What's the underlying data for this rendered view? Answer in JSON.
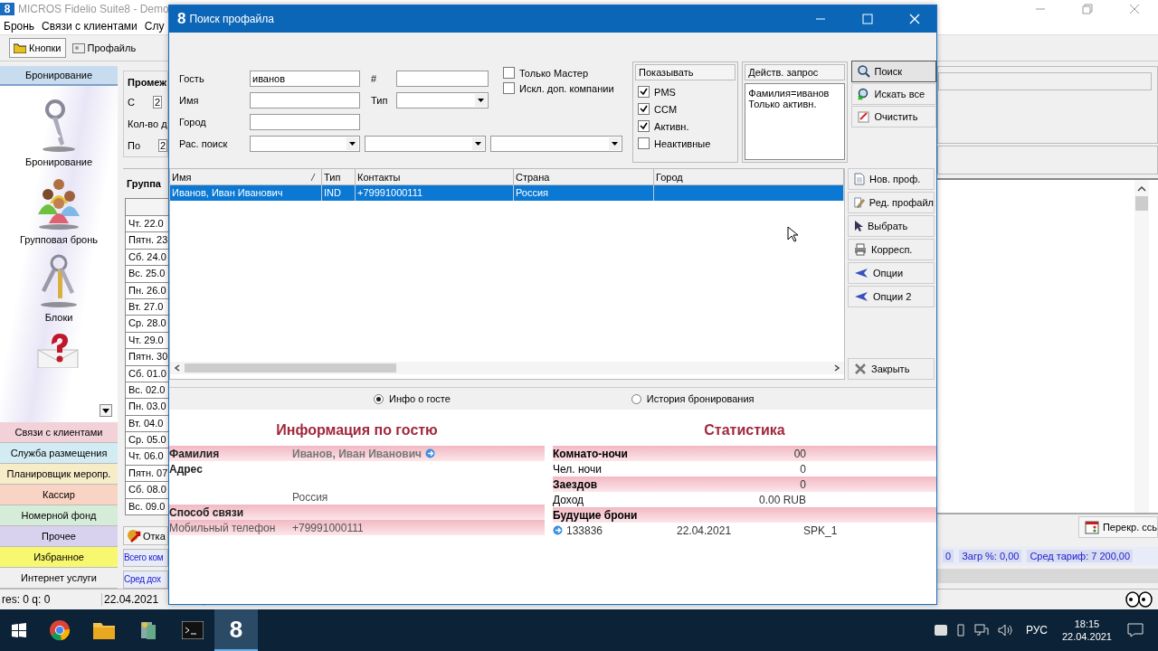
{
  "app": {
    "logo": "8",
    "title": "MICROS Fidelio Suite8 - Demo",
    "menu": [
      "Бронь",
      "Связи с клиентами",
      "Слу"
    ],
    "toolbar": [
      {
        "label": "Кнопки",
        "kind": "buttons",
        "selected": true
      },
      {
        "label": "Профайль",
        "kind": "profile",
        "selected": false
      }
    ]
  },
  "sidebar": {
    "header": "Бронирование",
    "shortcuts": [
      {
        "label": "Бронирование",
        "kind": "key"
      },
      {
        "label": "Групповая бронь",
        "kind": "people"
      },
      {
        "label": "Блоки",
        "kind": "keys"
      },
      {
        "kind": "help"
      }
    ],
    "sections": [
      {
        "label": "Связи с клиентами",
        "color": "#f2d2d8"
      },
      {
        "label": "Служба размещения",
        "color": "#d3ecf4"
      },
      {
        "label": "Планировщик меропр.",
        "color": "#f7ecc8"
      },
      {
        "label": "Кассир",
        "color": "#f9d3c3"
      },
      {
        "label": "Номерной фонд",
        "color": "#d5ecd8"
      },
      {
        "label": "Прочее",
        "color": "#d8d2ee"
      },
      {
        "label": "Избранное",
        "color": "#f8f870"
      },
      {
        "label": "Интернет услуги",
        "color": "#f0f0f0"
      }
    ]
  },
  "middle": {
    "period_title": "Промеж",
    "fields": [
      {
        "label": "С",
        "value": "2"
      },
      {
        "label": "Кол-во д"
      },
      {
        "label": "По",
        "value": "2"
      }
    ],
    "group_title": "Группа",
    "dates": [
      "Чт. 22.0",
      "Пятн. 23",
      "Сб. 24.0",
      "Вс. 25.0",
      "Пн. 26.0",
      "Вт. 27.0",
      "Ср. 28.0",
      "Чт. 29.0",
      "Пятн. 30",
      "Сб. 01.0",
      "Вс. 02.0",
      "Пн. 03.0",
      "Вт. 04.0",
      "Ср. 05.0",
      "Чт. 06.0",
      "Пятн. 07",
      "Сб. 08.0",
      "Вс. 09.0"
    ],
    "cancel_button": "Отка",
    "totals": [
      "Всего ком",
      "Сред дох"
    ]
  },
  "right_panel": {
    "overbook_button": "Перекр. ссь",
    "stats": [
      "0",
      "Загр %: 0,00",
      "Сред тариф: 7 200,00"
    ]
  },
  "status_bar": [
    "res: 0 q: 0",
    "22.04.2021"
  ],
  "dialog": {
    "logo": "8",
    "title": "Поиск профайла",
    "search": {
      "fields": [
        {
          "label": "Гость",
          "value": "иванов"
        },
        {
          "label": "Имя"
        },
        {
          "label": "Город"
        }
      ],
      "number_label": "#",
      "type_label": "Тип",
      "wide_search_label": "Рас. поиск",
      "checks": [
        {
          "label": "Только Мастер",
          "checked": false
        },
        {
          "label": "Искл. доп. компании",
          "checked": false
        }
      ]
    },
    "show": {
      "title": "Показывать",
      "options": [
        {
          "label": "PMS",
          "checked": true
        },
        {
          "label": "CCM",
          "checked": true
        },
        {
          "label": "Активн.",
          "checked": true
        },
        {
          "label": "Неактивные",
          "checked": false
        }
      ]
    },
    "query": {
      "title": "Действ. запрос",
      "lines": [
        "Фамилия=иванов",
        "Только активн."
      ]
    },
    "top_buttons": [
      {
        "label": "Поиск",
        "kind": "search"
      },
      {
        "label": "Искать все",
        "kind": "search-all"
      },
      {
        "label": "Очистить",
        "kind": "clear"
      }
    ],
    "table": {
      "columns": [
        "Имя",
        "Тип",
        "Контакты",
        "Страна",
        "Город"
      ],
      "rows": [
        {
          "name": "Иванов, Иван Иванович",
          "type": "IND",
          "contacts": "+79991000111",
          "country": "Россия",
          "selected": true
        }
      ]
    },
    "side_buttons": [
      {
        "label": "Нов. проф.",
        "kind": "new"
      },
      {
        "label": "Ред. профайл",
        "kind": "edit"
      },
      {
        "label": "Выбрать",
        "kind": "select"
      },
      {
        "label": "Корресп.",
        "kind": "print"
      },
      {
        "label": "Опции",
        "kind": "options"
      },
      {
        "label": "Опции 2",
        "kind": "options"
      }
    ],
    "close_button": "Закрыть",
    "views": [
      {
        "label": "Инфо о госте",
        "selected": true
      },
      {
        "label": "История бронирования",
        "selected": false
      }
    ],
    "guest_info": {
      "title": "Информация по гостю",
      "rows": [
        {
          "label": "Фамилия",
          "value": "Иванов, Иван Иванович",
          "kind": "name",
          "shaded": true
        },
        {
          "label": "Адрес",
          "kind": "heading",
          "shaded": false
        },
        {
          "value": "Россия",
          "kind": "detail",
          "shaded": false
        },
        {
          "label": "Способ связи",
          "kind": "heading",
          "shaded": true
        },
        {
          "label": "Мобильный телефон",
          "value": "+79991000111",
          "kind": "detail",
          "shaded": true
        }
      ]
    },
    "stats": {
      "title": "Статистика",
      "rows": [
        {
          "label": "Комнато-ночи",
          "value": "00",
          "shaded": true
        },
        {
          "label": "Чел. ночи",
          "value": "0",
          "shaded": false
        },
        {
          "label": "Заездов",
          "value": "0",
          "shaded": true
        },
        {
          "label": "Доход",
          "value": "0.00 RUB",
          "shaded": false
        },
        {
          "label": "Будущие брони",
          "shaded": true
        }
      ],
      "future": [
        {
          "number": "133836",
          "date": "22.04.2021",
          "code": "SPK_1"
        }
      ]
    }
  },
  "taskbar": {
    "apps": [
      {
        "kind": "browser"
      },
      {
        "kind": "folder"
      },
      {
        "kind": "server"
      },
      {
        "kind": "terminal"
      },
      {
        "kind": "suite",
        "label": "8"
      }
    ],
    "language": "РУС",
    "time": "18:15",
    "date": "22.04.2021"
  }
}
